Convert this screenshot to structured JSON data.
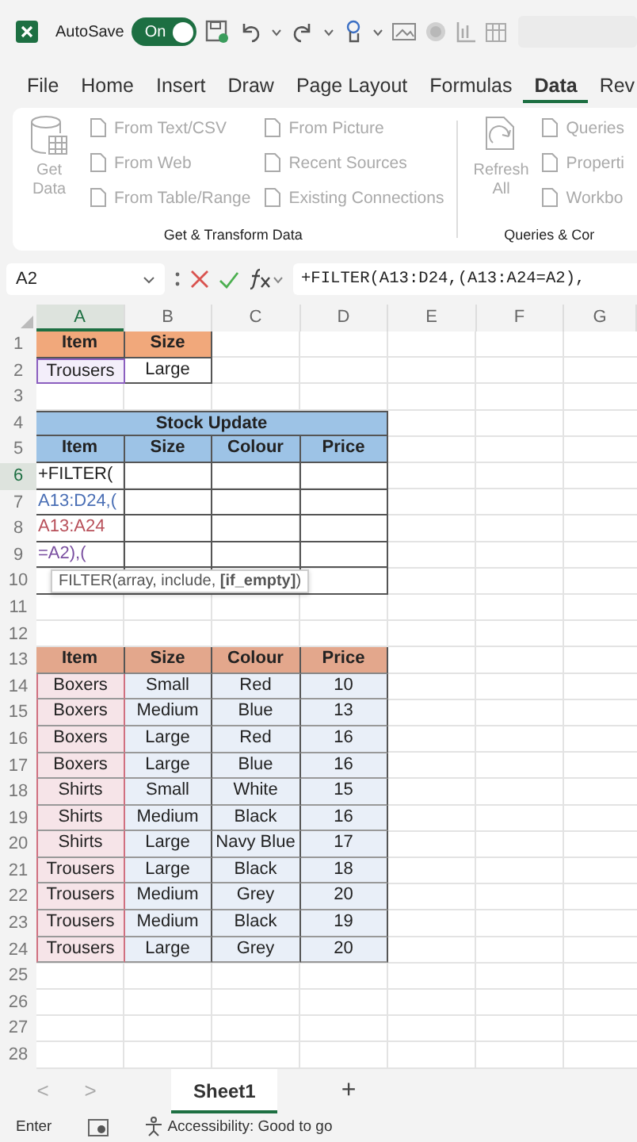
{
  "title_bar": {
    "autosave_label": "AutoSave",
    "autosave_toggle": {
      "label": "On",
      "on": true
    }
  },
  "tabs": [
    {
      "label": "File",
      "selected": false
    },
    {
      "label": "Home",
      "selected": false
    },
    {
      "label": "Insert",
      "selected": false
    },
    {
      "label": "Draw",
      "selected": false
    },
    {
      "label": "Page Layout",
      "selected": false
    },
    {
      "label": "Formulas",
      "selected": false
    },
    {
      "label": "Data",
      "selected": true
    },
    {
      "label": "Rev",
      "selected": false
    }
  ],
  "ribbon": {
    "groups": [
      {
        "title": "Get & Transform Data",
        "big_button": {
          "lines": [
            "Get",
            "Data"
          ],
          "disabled": true
        },
        "columns": [
          [
            {
              "label": "From Text/CSV",
              "disabled": true
            },
            {
              "label": "From Web",
              "disabled": true
            },
            {
              "label": "From Table/Range",
              "disabled": true
            }
          ],
          [
            {
              "label": "From Picture",
              "disabled": true
            },
            {
              "label": "Recent Sources",
              "disabled": true
            },
            {
              "label": "Existing Connections",
              "disabled": true
            }
          ]
        ]
      },
      {
        "title": "Queries & Cor",
        "big_button": {
          "lines": [
            "Refresh",
            "All"
          ],
          "disabled": true
        },
        "columns": [
          [
            {
              "label": "Queries",
              "disabled": true
            },
            {
              "label": "Properti",
              "disabled": true
            },
            {
              "label": "Workbo",
              "disabled": true
            }
          ]
        ]
      }
    ]
  },
  "formula_bar": {
    "name_box": "A2",
    "formula": "+FILTER(A13:D24,(A13:A24=A2),"
  },
  "sheet": {
    "columns": [
      {
        "label": "A",
        "selected": true
      },
      {
        "label": "B",
        "selected": false
      },
      {
        "label": "C",
        "selected": false
      },
      {
        "label": "D",
        "selected": false
      },
      {
        "label": "E",
        "selected": false
      },
      {
        "label": "F",
        "selected": false
      },
      {
        "label": "G",
        "selected": false
      }
    ],
    "rows": [
      {
        "number": "1",
        "selected": false,
        "kind": "lookup-header",
        "cells": [
          "Item",
          "Size"
        ]
      },
      {
        "number": "2",
        "selected": false,
        "kind": "lookup",
        "cells": [
          "Trousers",
          "Large"
        ]
      },
      {
        "number": "3",
        "selected": false,
        "kind": "blank",
        "cells": []
      },
      {
        "number": "4",
        "selected": false,
        "kind": "title",
        "cells": [
          "",
          "Stock Update"
        ]
      },
      {
        "number": "5",
        "selected": false,
        "kind": "header",
        "cells": [
          "Item",
          "Size",
          "Colour",
          "Price"
        ]
      },
      {
        "number": "6",
        "selected": true,
        "kind": "entry",
        "cells": [
          {
            "text": "+FILTER(",
            "color": "#1f1f1f"
          }
        ]
      },
      {
        "number": "7",
        "selected": false,
        "kind": "entry",
        "cells": [
          {
            "text": "A13:D24,(",
            "color": "#4a6fb5"
          }
        ]
      },
      {
        "number": "8",
        "selected": false,
        "kind": "entry",
        "cells": [
          {
            "text": "A13:A24",
            "color": "#b8505a"
          }
        ]
      },
      {
        "number": "9",
        "selected": false,
        "kind": "entry",
        "cells": [
          {
            "text": "=A2),(",
            "color": "#7a4fa0"
          }
        ]
      },
      {
        "number": "10",
        "selected": false,
        "kind": "entry",
        "cells": []
      },
      {
        "number": "11",
        "selected": false,
        "kind": "blank",
        "cells": []
      },
      {
        "number": "12",
        "selected": false,
        "kind": "blank",
        "cells": []
      },
      {
        "number": "13",
        "selected": false,
        "kind": "source-header",
        "cells": [
          "Item",
          "Size",
          "Colour",
          "Price"
        ]
      },
      {
        "number": "14",
        "selected": false,
        "kind": "source",
        "cells": [
          "Boxers",
          "Small",
          "Red",
          "10"
        ]
      },
      {
        "number": "15",
        "selected": false,
        "kind": "source",
        "cells": [
          "Boxers",
          "Medium",
          "Blue",
          "13"
        ]
      },
      {
        "number": "16",
        "selected": false,
        "kind": "source",
        "cells": [
          "Boxers",
          "Large",
          "Red",
          "16"
        ]
      },
      {
        "number": "17",
        "selected": false,
        "kind": "source",
        "cells": [
          "Boxers",
          "Large",
          "Blue",
          "16"
        ]
      },
      {
        "number": "18",
        "selected": false,
        "kind": "source",
        "cells": [
          "Shirts",
          "Small",
          "White",
          "15"
        ]
      },
      {
        "number": "19",
        "selected": false,
        "kind": "source",
        "cells": [
          "Shirts",
          "Medium",
          "Black",
          "16"
        ]
      },
      {
        "number": "20",
        "selected": false,
        "kind": "source",
        "cells": [
          "Shirts",
          "Large",
          "Navy Blue",
          "17"
        ]
      },
      {
        "number": "21",
        "selected": false,
        "kind": "source",
        "cells": [
          "Trousers",
          "Large",
          "Black",
          "18"
        ]
      },
      {
        "number": "22",
        "selected": false,
        "kind": "source",
        "cells": [
          "Trousers",
          "Medium",
          "Grey",
          "20"
        ]
      },
      {
        "number": "23",
        "selected": false,
        "kind": "source",
        "cells": [
          "Trousers",
          "Medium",
          "Black",
          "19"
        ]
      },
      {
        "number": "24",
        "selected": false,
        "kind": "source",
        "cells": [
          "Trousers",
          "Large",
          "Grey",
          "20"
        ]
      },
      {
        "number": "25",
        "selected": false,
        "kind": "blank",
        "cells": []
      },
      {
        "number": "26",
        "selected": false,
        "kind": "blank",
        "cells": []
      },
      {
        "number": "27",
        "selected": false,
        "kind": "blank",
        "cells": []
      },
      {
        "number": "28",
        "selected": false,
        "kind": "blank",
        "cells": []
      }
    ],
    "tooltip": "FILTER(array, include, **[if_empty]**)"
  },
  "sheet_tabs": {
    "prev": "<",
    "next": ">",
    "tabs": [
      {
        "label": "Sheet1",
        "selected": true
      }
    ],
    "add": "+"
  },
  "status_bar": {
    "mode": "Enter",
    "accessibility": "Accessibility: Good to go"
  }
}
